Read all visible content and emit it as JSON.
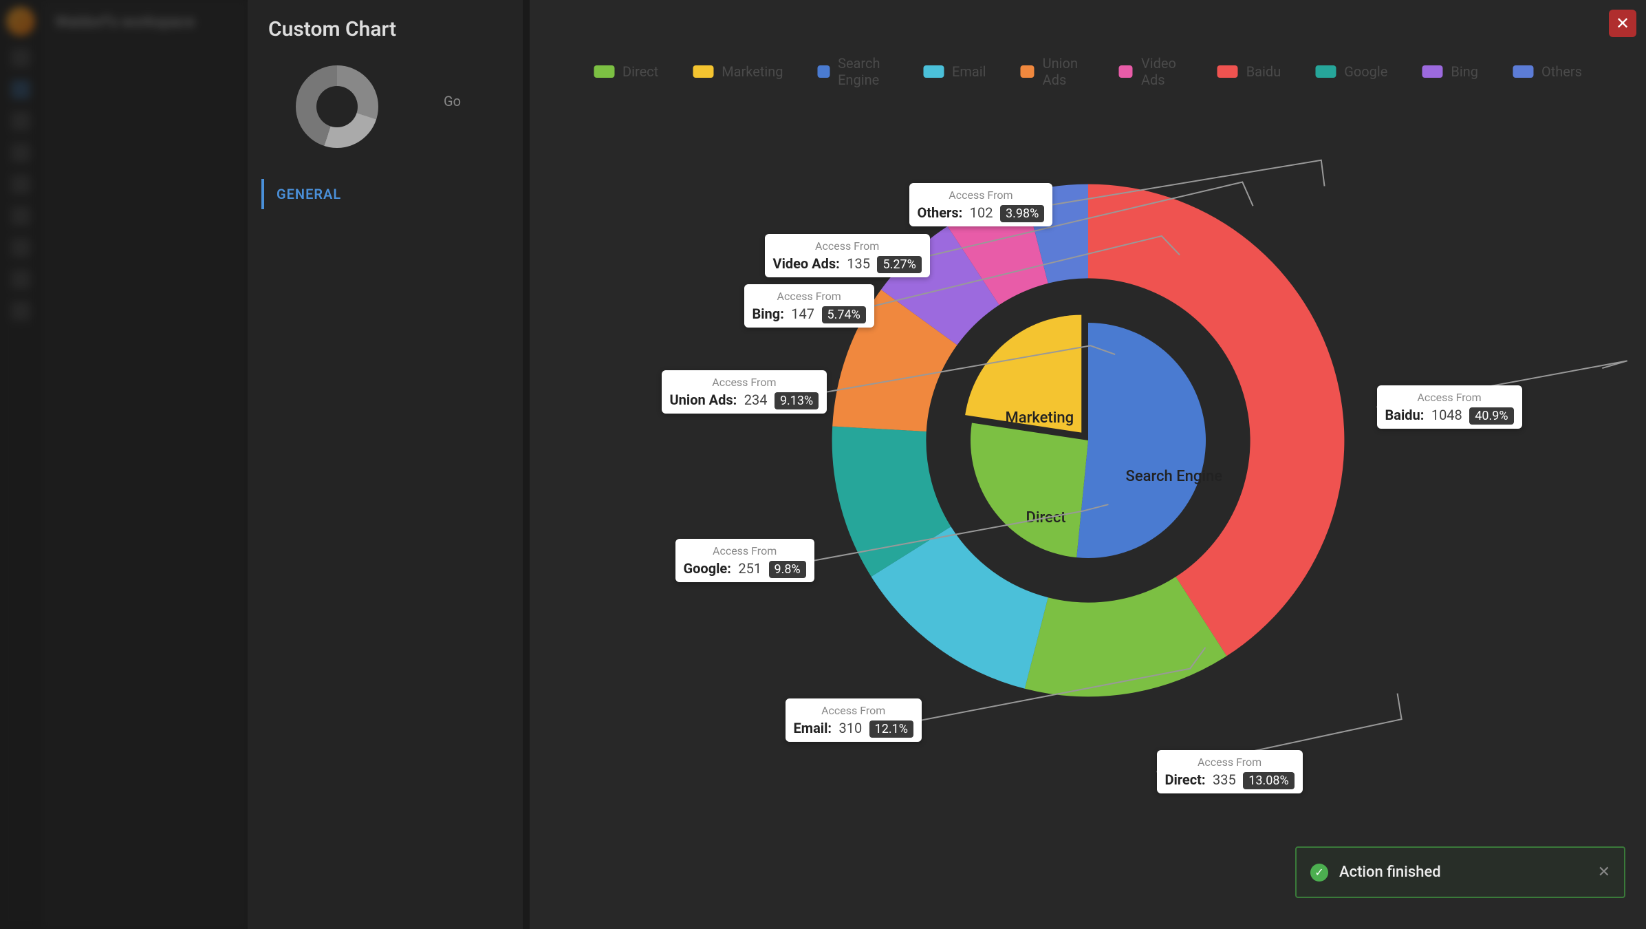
{
  "app": {
    "workspace_label": "Waldorf's workspace",
    "panel_title": "Custom Chart",
    "panel_tab": "GENERAL",
    "preview_go": "Go"
  },
  "legend": [
    {
      "name": "Direct",
      "color": "#7cc043"
    },
    {
      "name": "Marketing",
      "color": "#f4c430"
    },
    {
      "name": "Search Engine",
      "color": "#4a7bd1"
    },
    {
      "name": "Email",
      "color": "#4bc0d9"
    },
    {
      "name": "Union Ads",
      "color": "#f0883e"
    },
    {
      "name": "Video Ads",
      "color": "#e85ca8"
    },
    {
      "name": "Baidu",
      "color": "#ef5350"
    },
    {
      "name": "Google",
      "color": "#26a69a"
    },
    {
      "name": "Bing",
      "color": "#9c6ade"
    },
    {
      "name": "Others",
      "color": "#5c7cd6"
    }
  ],
  "callouts": {
    "sub": "Access From",
    "baidu": {
      "name": "Baidu:",
      "val": "1048",
      "pct": "40.9%"
    },
    "direct": {
      "name": "Direct:",
      "val": "335",
      "pct": "13.08%"
    },
    "email": {
      "name": "Email:",
      "val": "310",
      "pct": "12.1%"
    },
    "google": {
      "name": "Google:",
      "val": "251",
      "pct": "9.8%"
    },
    "union": {
      "name": "Union Ads:",
      "val": "234",
      "pct": "9.13%"
    },
    "bing": {
      "name": "Bing:",
      "val": "147",
      "pct": "5.74%"
    },
    "video": {
      "name": "Video Ads:",
      "val": "135",
      "pct": "5.27%"
    },
    "others": {
      "name": "Others:",
      "val": "102",
      "pct": "3.98%"
    }
  },
  "inner_labels": {
    "search_engine": "Search Engine",
    "direct": "Direct",
    "marketing": "Marketing"
  },
  "toast": {
    "message": "Action finished"
  },
  "chart_data": {
    "type": "pie",
    "title": "",
    "subtitle": "Access From",
    "series": [
      {
        "name": "Inner",
        "radius_inner": 0,
        "radius_outer": 0.45,
        "data": [
          {
            "name": "Search Engine",
            "value": 1548,
            "color": "#4a7bd1"
          },
          {
            "name": "Direct",
            "value": 775,
            "color": "#7cc043"
          },
          {
            "name": "Marketing",
            "value": 679,
            "color": "#f4c430",
            "selected": true
          }
        ]
      },
      {
        "name": "Outer",
        "radius_inner": 0.62,
        "radius_outer": 0.98,
        "data": [
          {
            "name": "Baidu",
            "value": 1048,
            "percent": 40.9,
            "color": "#ef5350"
          },
          {
            "name": "Direct",
            "value": 335,
            "percent": 13.08,
            "color": "#7cc043"
          },
          {
            "name": "Email",
            "value": 310,
            "percent": 12.1,
            "color": "#4bc0d9"
          },
          {
            "name": "Google",
            "value": 251,
            "percent": 9.8,
            "color": "#26a69a"
          },
          {
            "name": "Union Ads",
            "value": 234,
            "percent": 9.13,
            "color": "#f0883e"
          },
          {
            "name": "Bing",
            "value": 147,
            "percent": 5.74,
            "color": "#9c6ade"
          },
          {
            "name": "Video Ads",
            "value": 135,
            "percent": 5.27,
            "color": "#e85ca8"
          },
          {
            "name": "Others",
            "value": 102,
            "percent": 3.98,
            "color": "#5c7cd6"
          }
        ]
      }
    ]
  }
}
